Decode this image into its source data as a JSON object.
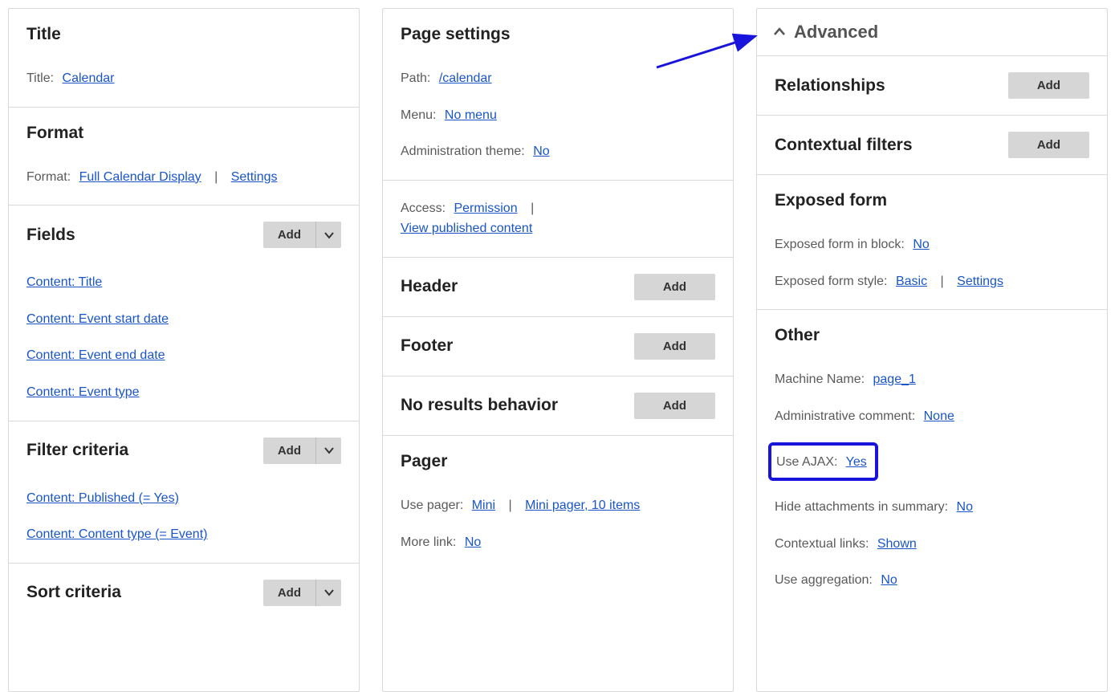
{
  "buttons": {
    "add": "Add"
  },
  "col1": {
    "title_block": {
      "heading": "Title",
      "label": "Title:",
      "value": "Calendar"
    },
    "format_block": {
      "heading": "Format",
      "label": "Format:",
      "format_link": "Full Calendar Display",
      "settings_link": "Settings"
    },
    "fields_block": {
      "heading": "Fields",
      "items": [
        "Content: Title",
        "Content: Event start date",
        "Content: Event end date",
        "Content: Event type"
      ]
    },
    "filter_block": {
      "heading": "Filter criteria",
      "items": [
        "Content: Published (= Yes)",
        "Content: Content type (= Event)"
      ]
    },
    "sort_block": {
      "heading": "Sort criteria"
    }
  },
  "col2": {
    "page_settings": {
      "heading": "Page settings",
      "path_label": "Path:",
      "path_value": "/calendar",
      "menu_label": "Menu:",
      "menu_value": "No menu",
      "admin_label": "Administration theme:",
      "admin_value": "No",
      "access_label": "Access:",
      "access_value": "Permission",
      "access_detail": "View published content"
    },
    "header": {
      "heading": "Header"
    },
    "footer": {
      "heading": "Footer"
    },
    "no_results": {
      "heading": "No results behavior"
    },
    "pager": {
      "heading": "Pager",
      "use_pager_label": "Use pager:",
      "use_pager_value": "Mini",
      "pager_settings": "Mini pager, 10 items",
      "more_label": "More link:",
      "more_value": "No"
    }
  },
  "col3": {
    "advanced": "Advanced",
    "relationships": {
      "heading": "Relationships"
    },
    "contextual_filters": {
      "heading": "Contextual filters"
    },
    "exposed_form": {
      "heading": "Exposed form",
      "block_label": "Exposed form in block:",
      "block_value": "No",
      "style_label": "Exposed form style:",
      "style_value": "Basic",
      "style_settings": "Settings"
    },
    "other": {
      "heading": "Other",
      "machine_label": "Machine Name:",
      "machine_value": "page_1",
      "admin_comment_label": "Administrative comment:",
      "admin_comment_value": "None",
      "ajax_label": "Use AJAX:",
      "ajax_value": "Yes",
      "hide_label": "Hide attachments in summary:",
      "hide_value": "No",
      "ctx_label": "Contextual links:",
      "ctx_value": "Shown",
      "agg_label": "Use aggregation:",
      "agg_value": "No"
    }
  }
}
